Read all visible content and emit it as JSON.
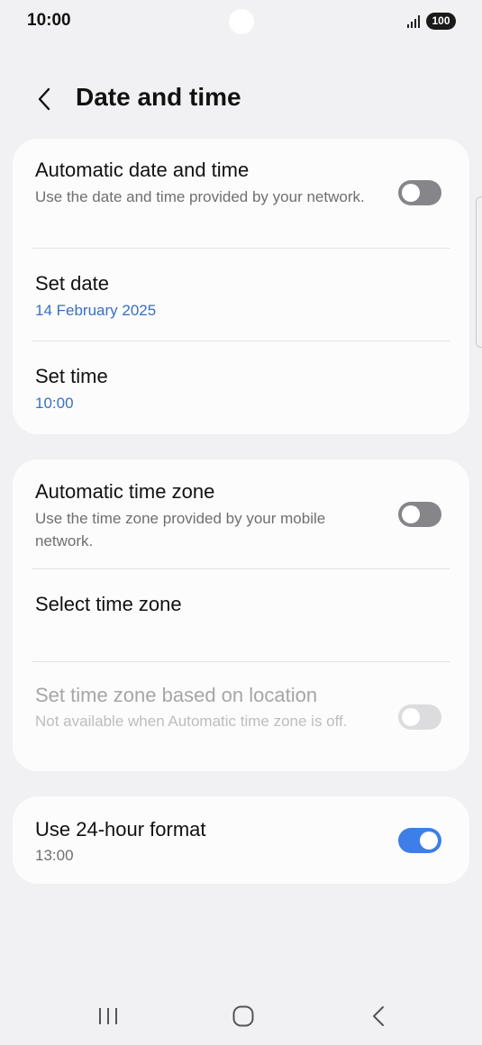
{
  "status": {
    "time": "10:00",
    "battery": "100"
  },
  "header": {
    "title": "Date and time"
  },
  "sections": {
    "datetime": {
      "auto_date_time": {
        "title": "Automatic date and time",
        "subtitle": "Use the date and time provided by your network.",
        "enabled": false
      },
      "set_date": {
        "title": "Set date",
        "value": "14 February 2025"
      },
      "set_time": {
        "title": "Set time",
        "value": "10:00"
      }
    },
    "timezone": {
      "auto_time_zone": {
        "title": "Automatic time zone",
        "subtitle": "Use the time zone provided by your mobile network.",
        "enabled": false
      },
      "select_time_zone": {
        "title": "Select time zone"
      },
      "location_time_zone": {
        "title": "Set time zone based on location",
        "subtitle": "Not available when Automatic time zone is off.",
        "enabled": false,
        "available": false
      }
    },
    "format": {
      "use_24_hour": {
        "title": "Use 24-hour format",
        "value": "13:00",
        "enabled": true
      }
    }
  },
  "colors": {
    "accent": "#3d7ee8",
    "value_blue": "#3a6fc3",
    "background": "#f1f1f3",
    "card": "#fcfcfd"
  },
  "icons": {
    "back": "chevron-left-icon",
    "recents": "recent-apps-icon",
    "home": "home-icon",
    "nav_back": "nav-back-icon"
  }
}
